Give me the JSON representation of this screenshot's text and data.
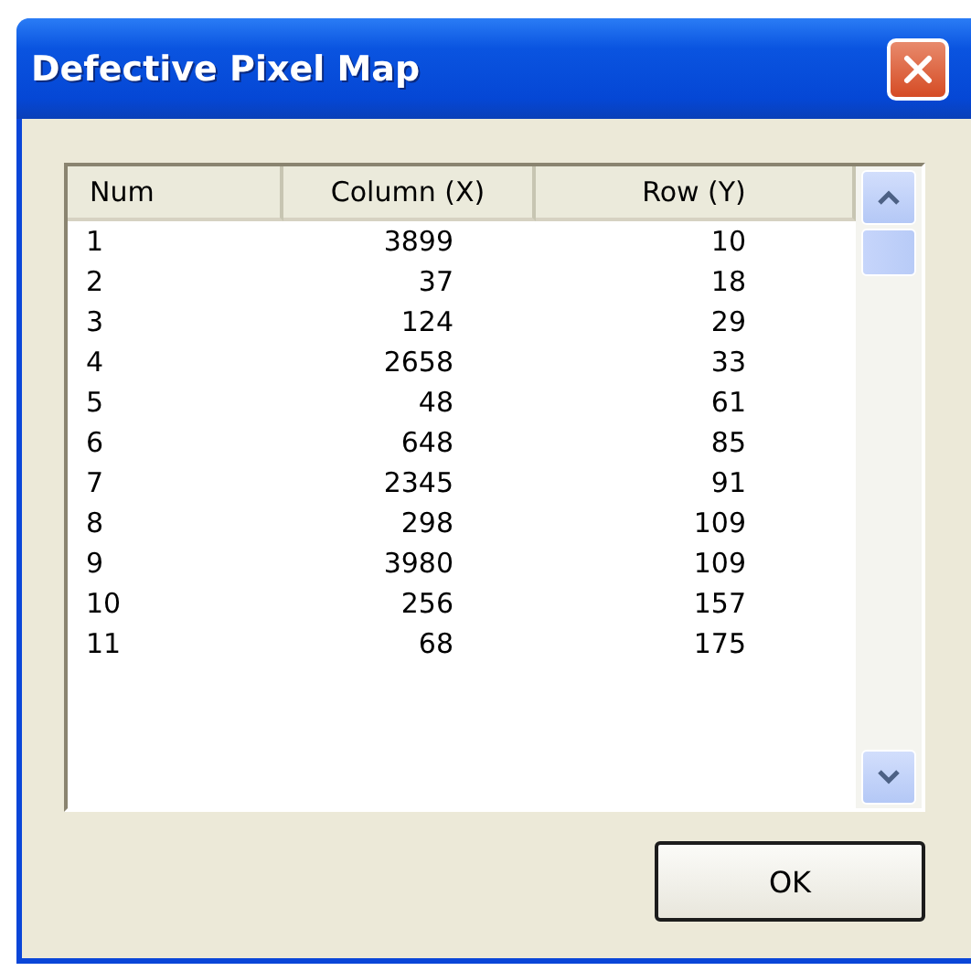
{
  "window": {
    "title": "Defective Pixel Map"
  },
  "table": {
    "columns": [
      "Num",
      "Column (X)",
      "Row (Y)"
    ],
    "rows": [
      [
        "1",
        "3899",
        "10"
      ],
      [
        "2",
        "37",
        "18"
      ],
      [
        "3",
        "124",
        "29"
      ],
      [
        "4",
        "2658",
        "33"
      ],
      [
        "5",
        "48",
        "61"
      ],
      [
        "6",
        "648",
        "85"
      ],
      [
        "7",
        "2345",
        "91"
      ],
      [
        "8",
        "298",
        "109"
      ],
      [
        "9",
        "3980",
        "109"
      ],
      [
        "10",
        "256",
        "157"
      ],
      [
        "11",
        "68",
        "175"
      ]
    ]
  },
  "buttons": [
    "OK"
  ]
}
